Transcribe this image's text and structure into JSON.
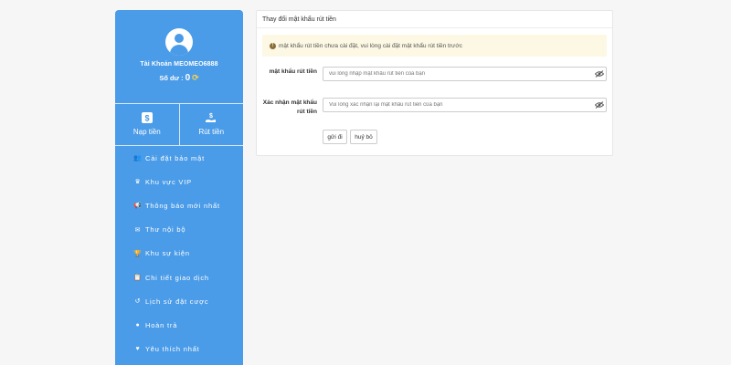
{
  "sidebar": {
    "account_name": "Tài Khoản MEOMEO6888",
    "balance_label": "Số dư :",
    "balance_value": "0",
    "deposit_label": "Nạp tiền",
    "withdraw_label": "Rút tiền",
    "menu": [
      {
        "label": "Cài đặt bảo mật",
        "icon": "user-shield-icon"
      },
      {
        "label": "Khu vực VIP",
        "icon": "crown-icon"
      },
      {
        "label": "Thông báo mới nhất",
        "icon": "megaphone-icon"
      },
      {
        "label": "Thư nội bộ",
        "icon": "envelope-icon"
      },
      {
        "label": "Khu sự kiện",
        "icon": "trophy-icon"
      },
      {
        "label": "Chi tiết giao dịch",
        "icon": "clipboard-icon"
      },
      {
        "label": "Lịch sử đặt cược",
        "icon": "history-icon"
      },
      {
        "label": "Hoàn trả",
        "icon": "coin-icon"
      },
      {
        "label": "Yêu thích nhất",
        "icon": "heart-icon"
      }
    ]
  },
  "panel": {
    "title": "Thay đổi mật khẩu rút tiền",
    "alert": "mật khẩu rút tiền chưa cài đặt, vui lòng cài đặt mật khẩu rút tiền trước",
    "password_label": "mật khẩu rút tiền",
    "password_placeholder": "vui lòng nhập mật khẩu rút tiền của bạn",
    "confirm_label": "Xác nhận mật khẩu rút tiền",
    "confirm_placeholder": "Vui lòng xác nhận lại mật khẩu rút tiền của bạn",
    "submit_label": "gửi đi",
    "cancel_label": "huỷ bỏ"
  },
  "colors": {
    "sidebar_bg": "#4a9be8",
    "alert_bg": "#fcf8e3",
    "refresh": "#f7d14c"
  }
}
